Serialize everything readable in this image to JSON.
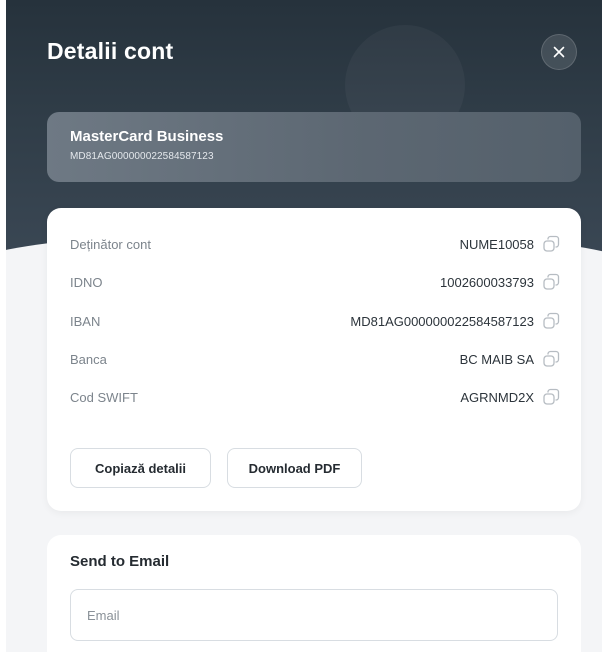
{
  "header": {
    "title": "Detalii cont",
    "close_icon": "close-icon"
  },
  "account_card": {
    "name": "MasterCard Business",
    "iban": "MD81AG000000022584587123"
  },
  "details": [
    {
      "label": "Deținător cont",
      "value": "NUME10058"
    },
    {
      "label": "IDNO",
      "value": "1002600033793"
    },
    {
      "label": "IBAN",
      "value": "MD81AG000000022584587123"
    },
    {
      "label": "Banca",
      "value": "BC MAIB SA"
    },
    {
      "label": "Cod SWIFT",
      "value": "AGRNMD2X"
    }
  ],
  "buttons": {
    "copy_details": "Copiază detalii",
    "download_pdf": "Download PDF"
  },
  "email_section": {
    "title": "Send to Email",
    "placeholder": "Email",
    "value": ""
  },
  "colors": {
    "header_bg": "#2b3742",
    "card_bg": "#66717c",
    "page_bg": "#f4f5f7"
  }
}
